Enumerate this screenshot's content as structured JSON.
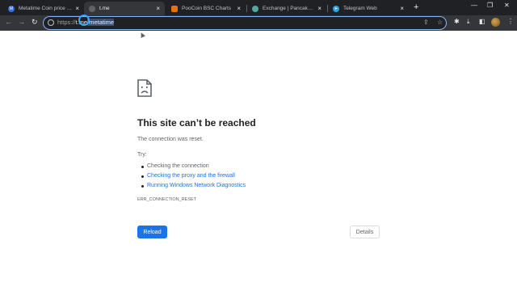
{
  "tabs": [
    {
      "title": "Metatime Coin price toda",
      "favicon": "metatime-favicon",
      "active": false
    },
    {
      "title": "t.me",
      "favicon": "globe-icon",
      "active": true
    },
    {
      "title": "PooCoin BSC Charts",
      "favicon": "poocoin-favicon",
      "active": false
    },
    {
      "title": "Exchange | PancakeSwap",
      "favicon": "pancakeswap-favicon",
      "active": false
    },
    {
      "title": "Telegram Web",
      "favicon": "telegram-favicon",
      "active": false
    }
  ],
  "address_bar": {
    "scheme": "https://",
    "host": "t.me",
    "path_selected": "/metatime"
  },
  "error_page": {
    "title": "This site can’t be reached",
    "description": "The connection was reset.",
    "try_label": "Try:",
    "suggestions": [
      {
        "text": "Checking the connection",
        "link": false
      },
      {
        "text": "Checking the proxy and the firewall",
        "link": true
      },
      {
        "text": "Running Windows Network Diagnostics",
        "link": true
      }
    ],
    "error_code": "ERR_CONNECTION_RESET",
    "reload_label": "Reload",
    "details_label": "Details"
  },
  "colors": {
    "accent": "#1a73e8",
    "tabstrip_bg": "#202124",
    "toolbar_bg": "#35363a"
  }
}
